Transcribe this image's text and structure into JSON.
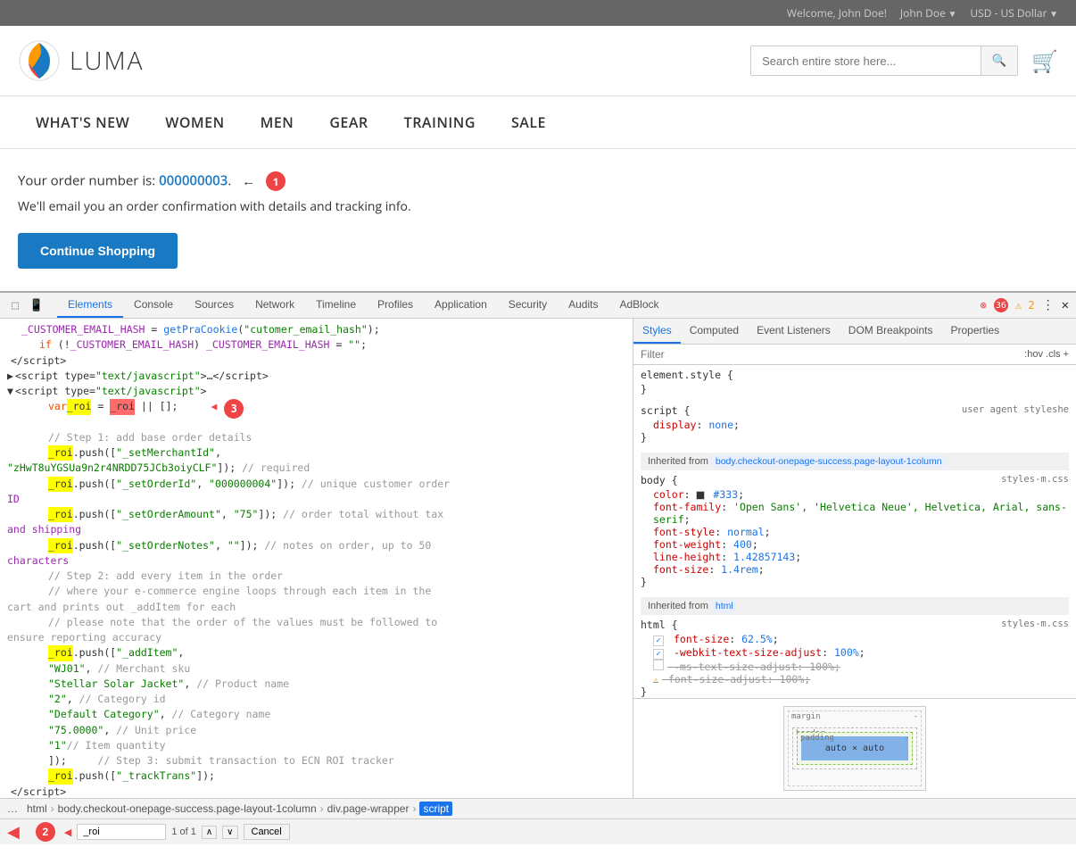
{
  "topbar": {
    "welcome": "Welcome, John Doe!",
    "user": "John Doe",
    "currency": "USD - US Dollar"
  },
  "header": {
    "logo_text": "LUMA",
    "search_placeholder": "Search entire store here...",
    "search_icon": "🔍",
    "cart_icon": "🛒"
  },
  "nav": {
    "items": [
      {
        "label": "What's New"
      },
      {
        "label": "Women"
      },
      {
        "label": "Men"
      },
      {
        "label": "Gear"
      },
      {
        "label": "Training"
      },
      {
        "label": "Sale"
      }
    ]
  },
  "main": {
    "order_prefix": "Your order number is: ",
    "order_number": "000000003",
    "order_suffix": ".",
    "email_notice": "We'll email you an order confirmation with details and tracking info.",
    "continue_btn": "Continue Shopping"
  },
  "devtools": {
    "tabs": [
      "Elements",
      "Console",
      "Sources",
      "Network",
      "Timeline",
      "Profiles",
      "Application",
      "Security",
      "Audits",
      "AdBlock"
    ],
    "active_tab": "Elements",
    "error_count": "36",
    "warning_count": "2",
    "styles_tabs": [
      "Styles",
      "Computed",
      "Event Listeners",
      "DOM Breakpoints",
      "Properties"
    ],
    "active_styles_tab": "Styles",
    "filter_placeholder": "Filter",
    "filter_right": ":hov .cls +",
    "css_blocks": [
      {
        "selector": "element.style {",
        "source": "",
        "props": []
      },
      {
        "selector": "script {",
        "source": "user agent styleshe",
        "props": [
          {
            "name": "display",
            "value": "none;"
          }
        ]
      }
    ],
    "inherited_body": "body.checkout-onepage-success.page-layout-1column",
    "inherited_html": "html",
    "body_source": "styles-m.css",
    "body_props": [
      {
        "name": "color",
        "value": "#333;"
      },
      {
        "name": "font-family",
        "value": "'Open Sans', 'Helvetica Neue', Helvetica, Arial, sans-serif;"
      },
      {
        "name": "font-style",
        "value": "normal;"
      },
      {
        "name": "font-weight",
        "value": "400;"
      },
      {
        "name": "line-height",
        "value": "1.42857143;"
      },
      {
        "name": "font-size",
        "value": "1.4rem;"
      }
    ],
    "html_source": "styles-m.css",
    "html_props": [
      {
        "name": "font-size",
        "value": "62.5%;",
        "checked": true,
        "strikethrough": false
      },
      {
        "name": "-webkit-text-size-adjust",
        "value": "100%;",
        "checked": true,
        "strikethrough": false
      },
      {
        "name": "-ms-text-size-adjust",
        "value": "100%;",
        "checked": false,
        "strikethrough": true
      },
      {
        "name": "font-size-adjust",
        "value": "100%;",
        "checked": false,
        "strikethrough": true,
        "warning": true
      }
    ],
    "breadcrumb": [
      "html",
      "body.checkout-onepage-success.page-layout-1column",
      "div.page-wrapper",
      "script"
    ],
    "active_breadcrumb": "script",
    "search_text": "_roi",
    "search_result": "1 of 1"
  },
  "annotations": {
    "1": "1",
    "2": "2",
    "3": "3"
  }
}
